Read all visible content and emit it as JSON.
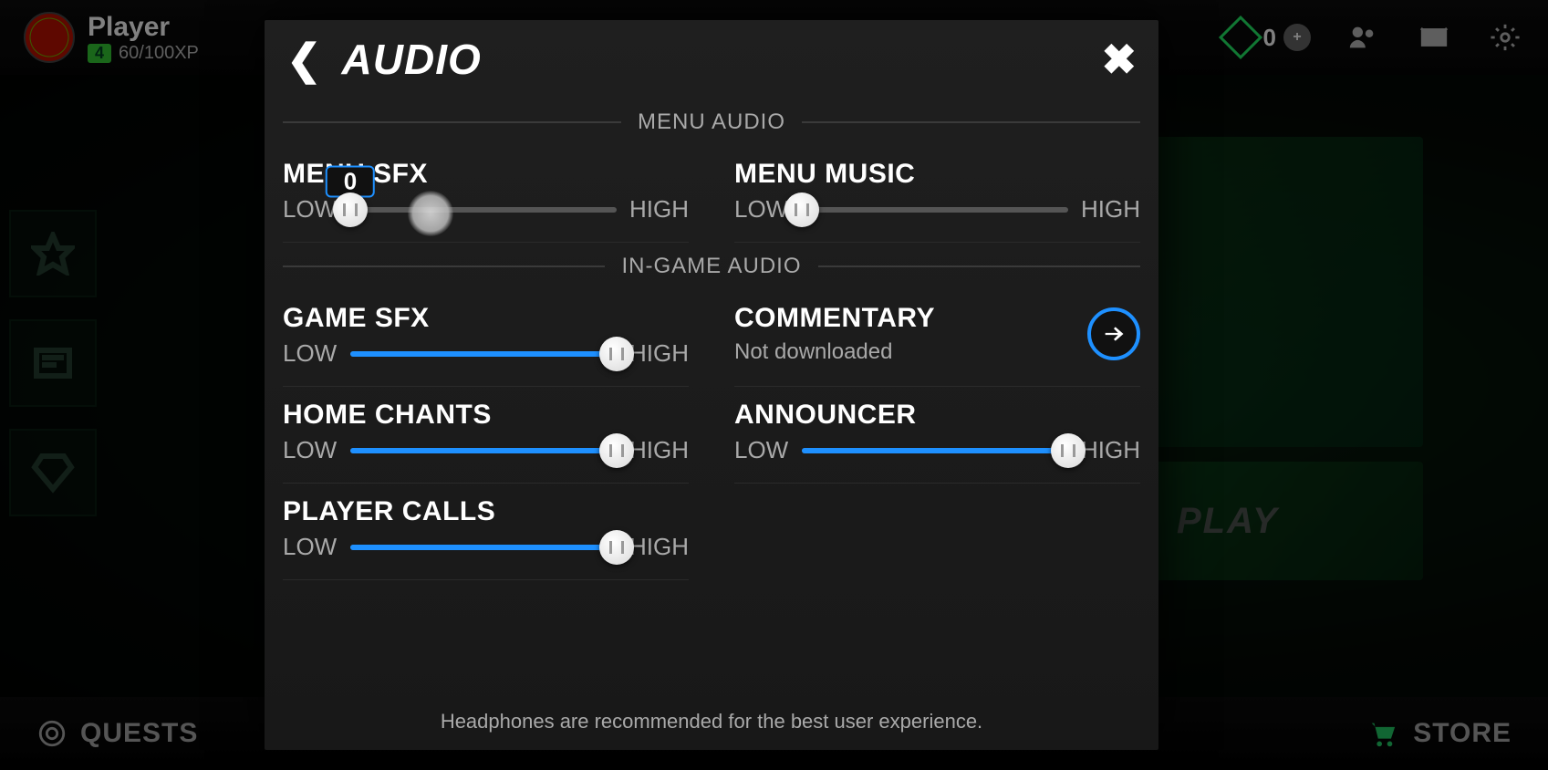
{
  "topbar": {
    "player_name": "Player",
    "level": "4",
    "xp": "60/100XP",
    "fc_balance": "0"
  },
  "bottombar": {
    "quests": "QUESTS",
    "store": "STORE"
  },
  "bg": {
    "play": "PLAY"
  },
  "modal": {
    "title": "AUDIO",
    "section_menu": "MENU AUDIO",
    "section_ingame": "IN-GAME AUDIO",
    "low": "LOW",
    "high": "HIGH",
    "footer": "Headphones are recommended for the best user experience.",
    "controls": {
      "menu_sfx": {
        "label": "MENU SFX",
        "value": 0,
        "bubble": "0"
      },
      "menu_music": {
        "label": "MENU MUSIC",
        "value": 0
      },
      "game_sfx": {
        "label": "GAME SFX",
        "value": 100
      },
      "commentary": {
        "label": "COMMENTARY",
        "status": "Not downloaded"
      },
      "home_chants": {
        "label": "HOME CHANTS",
        "value": 100
      },
      "announcer": {
        "label": "ANNOUNCER",
        "value": 100
      },
      "player_calls": {
        "label": "PLAYER CALLS",
        "value": 100
      }
    }
  }
}
